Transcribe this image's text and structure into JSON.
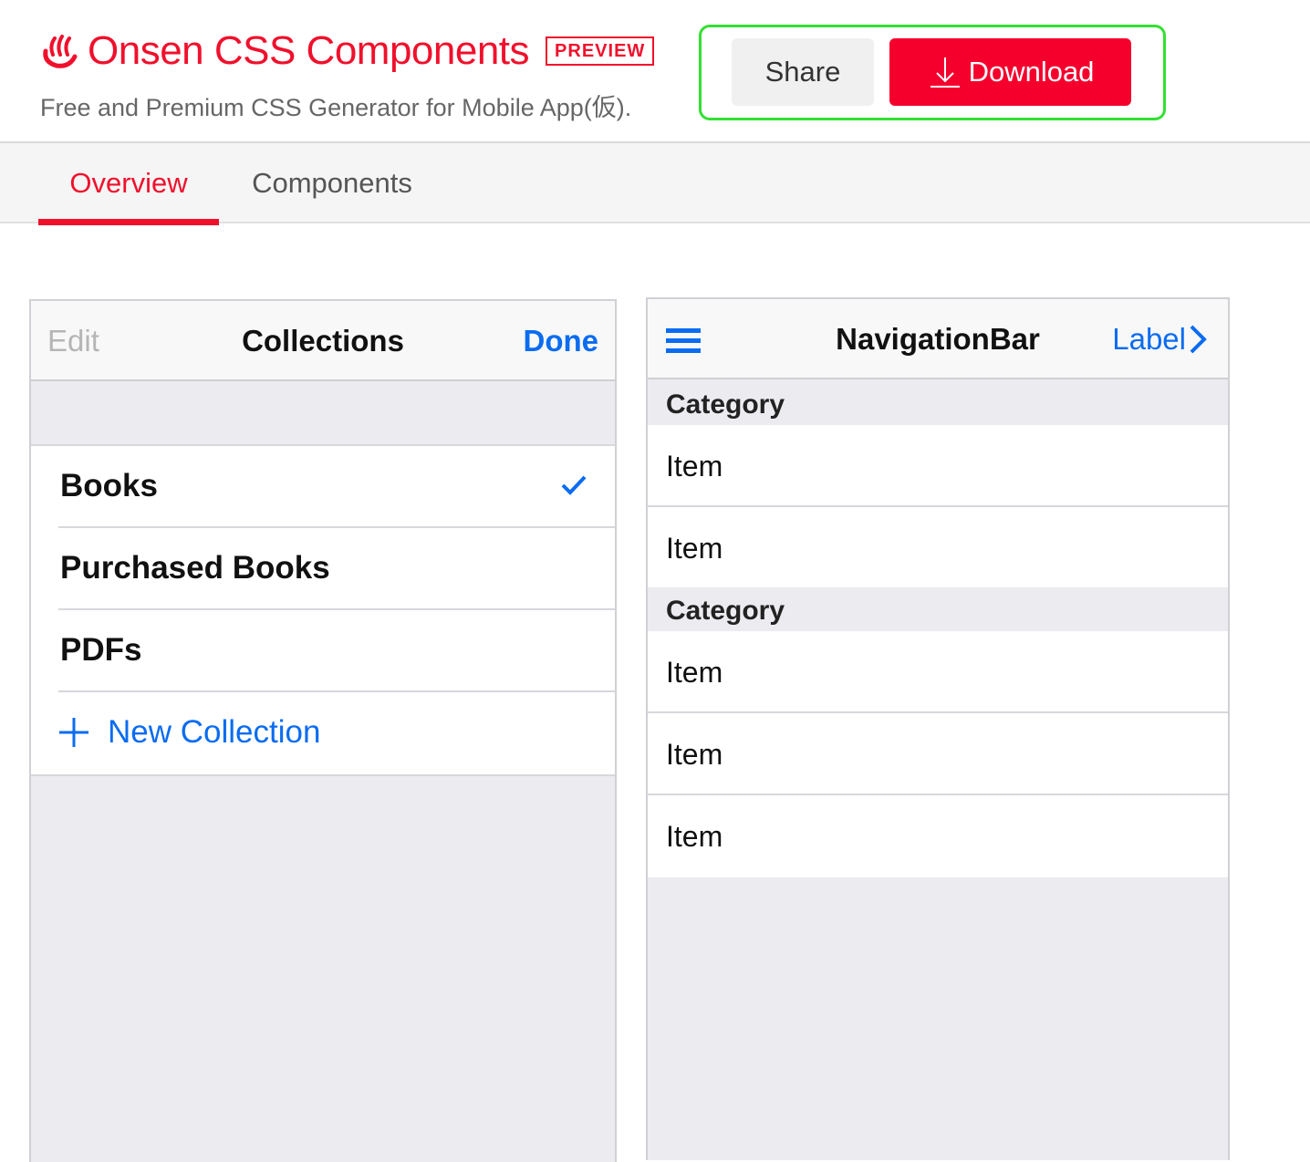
{
  "header": {
    "title": "Onsen CSS Components",
    "badge": "PREVIEW",
    "subtitle": "Free and Premium CSS Generator for Mobile App(仮).",
    "share_label": "Share",
    "download_label": "Download",
    "accent_color": "#f0102c"
  },
  "tabs": [
    {
      "label": "Overview",
      "active": true
    },
    {
      "label": "Components",
      "active": false
    }
  ],
  "left_panel": {
    "nav_left": "Edit",
    "nav_title": "Collections",
    "nav_right": "Done",
    "items": [
      {
        "label": "Books",
        "checked": true,
        "icon": "checkmark-icon"
      },
      {
        "label": "Purchased Books",
        "checked": false
      },
      {
        "label": "PDFs",
        "checked": false
      }
    ],
    "add_item": {
      "label": "New Collection",
      "icon": "plus-icon"
    }
  },
  "right_panel": {
    "nav_left_icon": "menu-icon",
    "nav_title": "NavigationBar",
    "nav_right": "Label",
    "nav_right_icon": "chevron-right-icon",
    "sections": [
      {
        "category": "Category",
        "items": [
          "Item",
          "Item"
        ]
      },
      {
        "category": "Category",
        "items": [
          "Item",
          "Item",
          "Item"
        ]
      }
    ]
  }
}
